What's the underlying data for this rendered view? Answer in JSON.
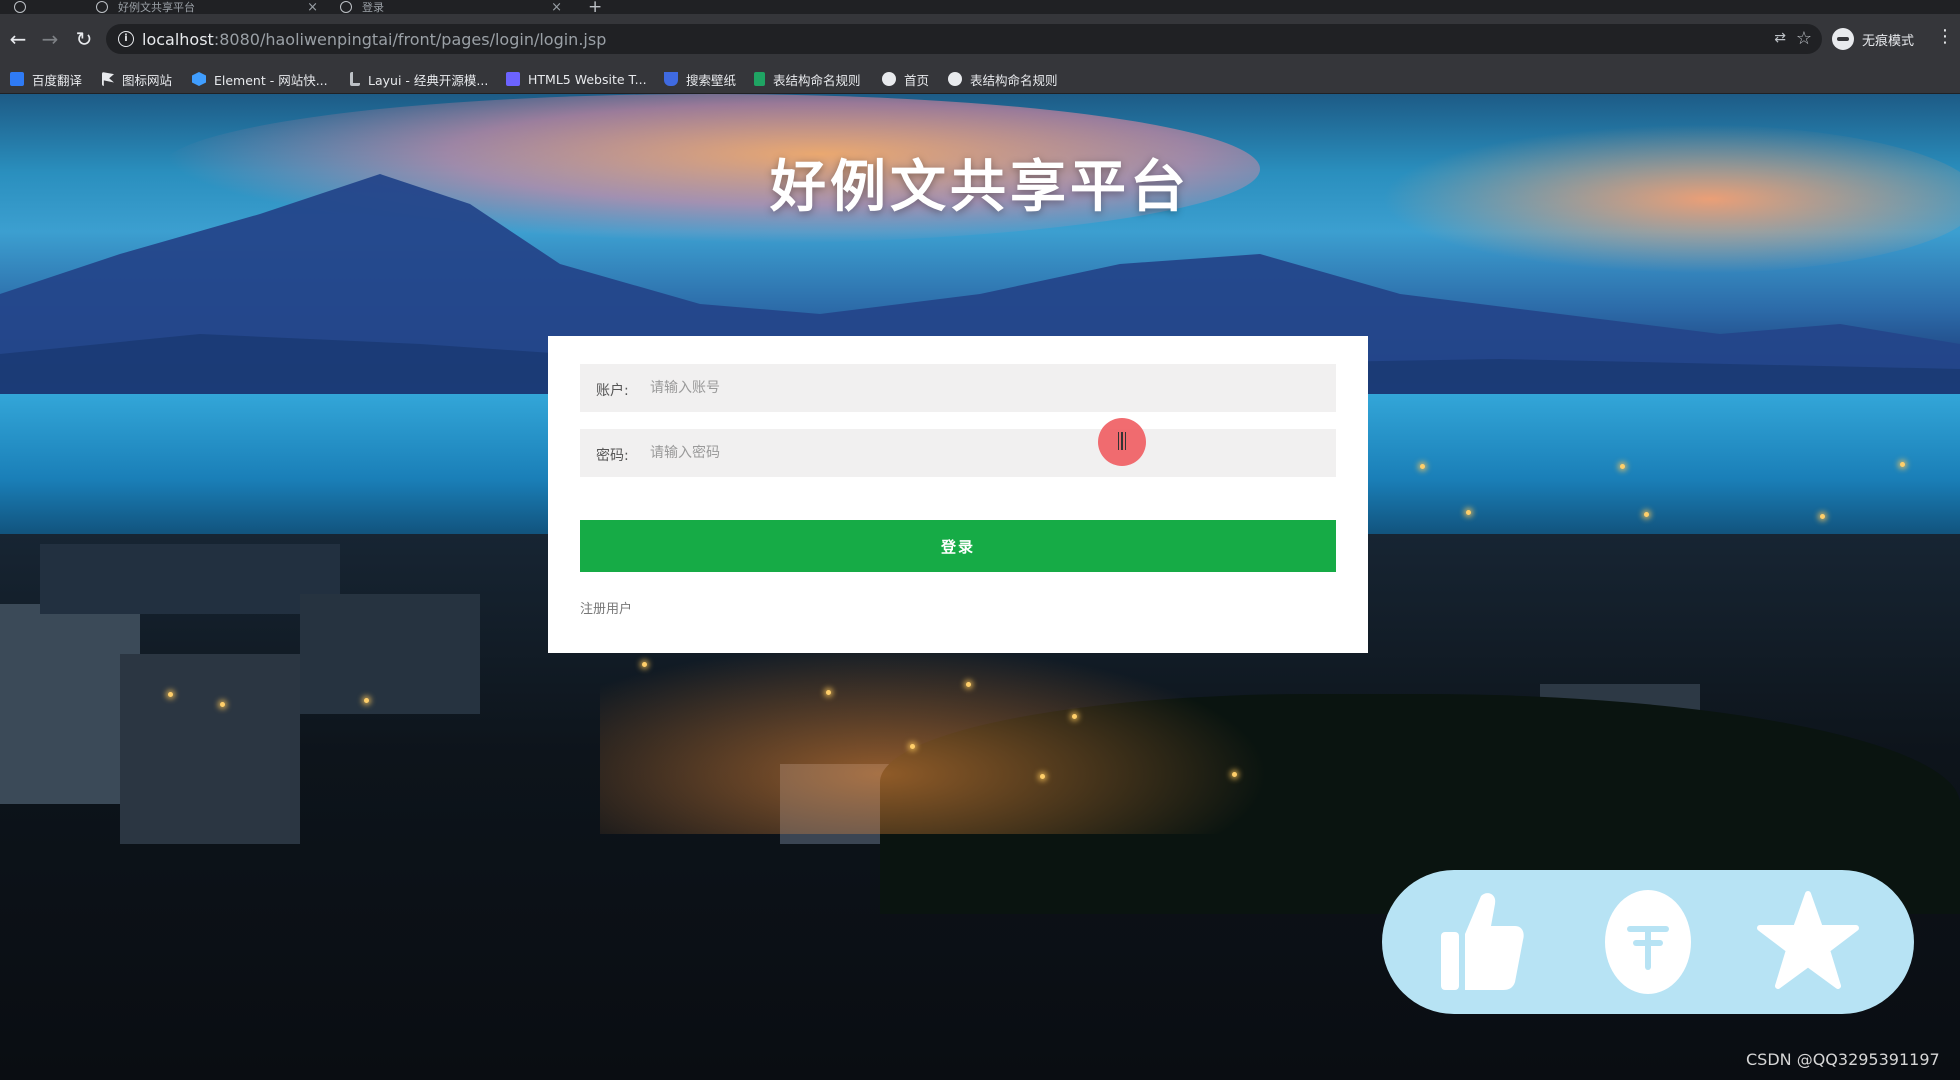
{
  "browser": {
    "tabs": [
      {
        "title": "好例文共享平台",
        "close": "×"
      },
      {
        "title": "登录",
        "close": "×"
      }
    ],
    "new_tab": "+",
    "url_host": "localhost",
    "url_rest": ":8080/haoliwenpingtai/front/pages/login/login.jsp",
    "incognito_label": "无痕模式",
    "bookmarks": [
      {
        "label": "百度翻译",
        "icon": "baidu-translate-icon",
        "color": "#2f7bf5"
      },
      {
        "label": "图标网站",
        "icon": "flag-icon",
        "color": "#e8eaed"
      },
      {
        "label": "Element - 网站快...",
        "icon": "element-hex-icon",
        "color": "#409eff"
      },
      {
        "label": "Layui - 经典开源模...",
        "icon": "layui-icon",
        "color": "#9aa0a6"
      },
      {
        "label": "HTML5 Website T...",
        "icon": "html5-template-icon",
        "color": "#6c63ff"
      },
      {
        "label": "搜索壁纸",
        "icon": "wallpaper-icon",
        "color": "#3f6ae0"
      },
      {
        "label": "表结构命名规则",
        "icon": "sheets-icon",
        "color": "#1fa463"
      },
      {
        "label": "首页",
        "icon": "globe-icon",
        "color": "#e8eaed"
      },
      {
        "label": "表结构命名规则",
        "icon": "globe-icon",
        "color": "#e8eaed"
      }
    ]
  },
  "page": {
    "title": "好例文共享平台",
    "account_label": "账户:",
    "account_placeholder": "请输入账号",
    "password_label": "密码:",
    "password_placeholder": "请输入密码",
    "login_button": "登录",
    "register_link": "注册用户",
    "accent_color": "#16ab46"
  },
  "overlay": {
    "actions": [
      "thumbs-up-icon",
      "coin-icon",
      "star-icon"
    ],
    "watermark": "CSDN @QQ3295391197"
  }
}
